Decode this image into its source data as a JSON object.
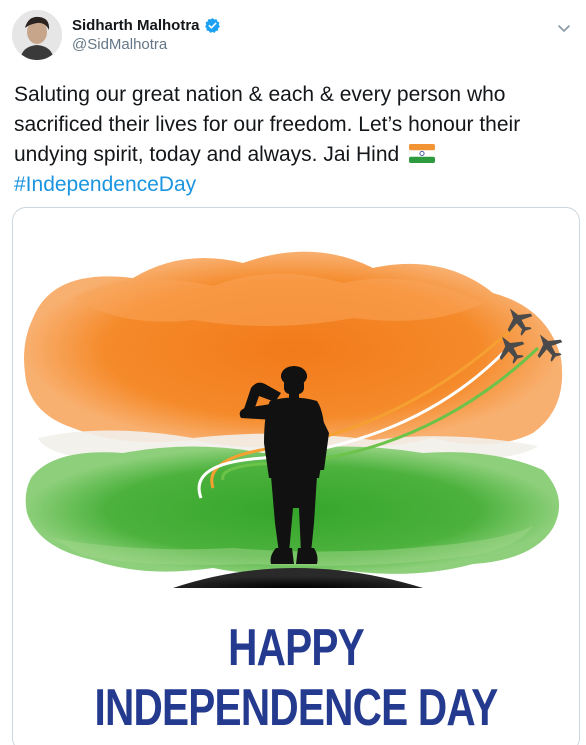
{
  "user": {
    "display_name": "Sidharth Malhotra",
    "handle": "@SidMalhotra",
    "verified": true,
    "avatar_icon": "avatar-photo"
  },
  "tweet": {
    "text": "Saluting our great nation & each & every person who sacrificed their lives for our freedom. Let’s honour their undying spirit, today and always. Jai Hind",
    "flag_emoji": "india-flag-icon",
    "hashtag": "#IndependenceDay"
  },
  "media": {
    "poster_title": "HAPPY INDEPENDENCE DAY"
  },
  "colors": {
    "link": "#1b95e0",
    "verified": "#1da1f2",
    "saffron": "#f27a1a",
    "green": "#3ea733",
    "title": "#243a8f"
  }
}
